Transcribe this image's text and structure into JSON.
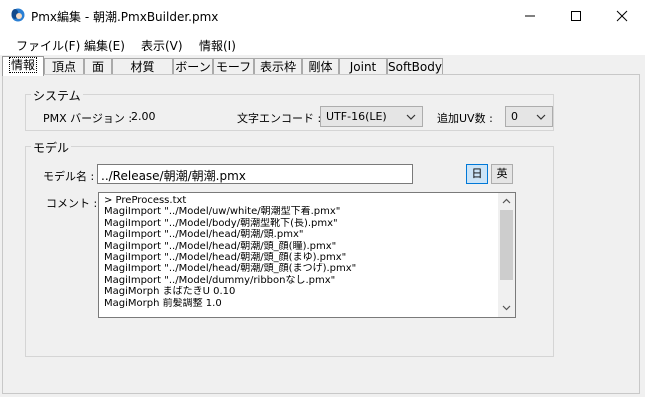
{
  "window": {
    "title": "Pmx編集 - 朝潮.PmxBuilder.pmx",
    "controls": [
      "minimize",
      "maximize",
      "close"
    ]
  },
  "menu": [
    {
      "label": "ファイル(F)"
    },
    {
      "label": "編集(E)"
    },
    {
      "label": "表示(V)"
    },
    {
      "label": "情報(I)"
    }
  ],
  "tabs": [
    {
      "label": "情報",
      "active": true
    },
    {
      "label": "頂点"
    },
    {
      "label": "面"
    },
    {
      "label": "材質"
    },
    {
      "label": "ボーン"
    },
    {
      "label": "モーフ"
    },
    {
      "label": "表示枠"
    },
    {
      "label": "剛体"
    },
    {
      "label": "Joint"
    },
    {
      "label": "SoftBody"
    }
  ],
  "system": {
    "group_label": "システム",
    "version_label": "PMX バージョン :",
    "version_value": "2.00",
    "encode_label": "文字エンコード :",
    "encode_value": "UTF-16(LE)",
    "uv_label": "追加UV数 :",
    "uv_value": "0"
  },
  "model": {
    "group_label": "モデル",
    "name_label": "モデル名 :",
    "name_value": "../Release/朝潮/朝潮.pmx",
    "lang_ja": "日",
    "lang_en": "英",
    "comment_label": "コメント :",
    "comment_lines": [
      "> PreProcess.txt",
      "MagiImport \"../Model/uw/white/朝潮型下着.pmx\"",
      "MagiImport \"../Model/body/朝潮型靴下(長).pmx\"",
      "MagiImport \"../Model/head/朝潮/頭.pmx\"",
      "MagiImport \"../Model/head/朝潮/頭_顔(瞳).pmx\"",
      "MagiImport \"../Model/head/朝潮/頭_顔(まゆ).pmx\"",
      "MagiImport \"../Model/head/朝潮/頭_顔(まつげ).pmx\"",
      "MagiImport \"../Model/dummy/ribbonなし.pmx\"",
      "MagiMorph まばたきU 0.10",
      "MagiMorph 前髪調整 1.0"
    ]
  },
  "colors": {
    "accent": "#0078d7",
    "lang_active_bg": "#cce4f7"
  }
}
